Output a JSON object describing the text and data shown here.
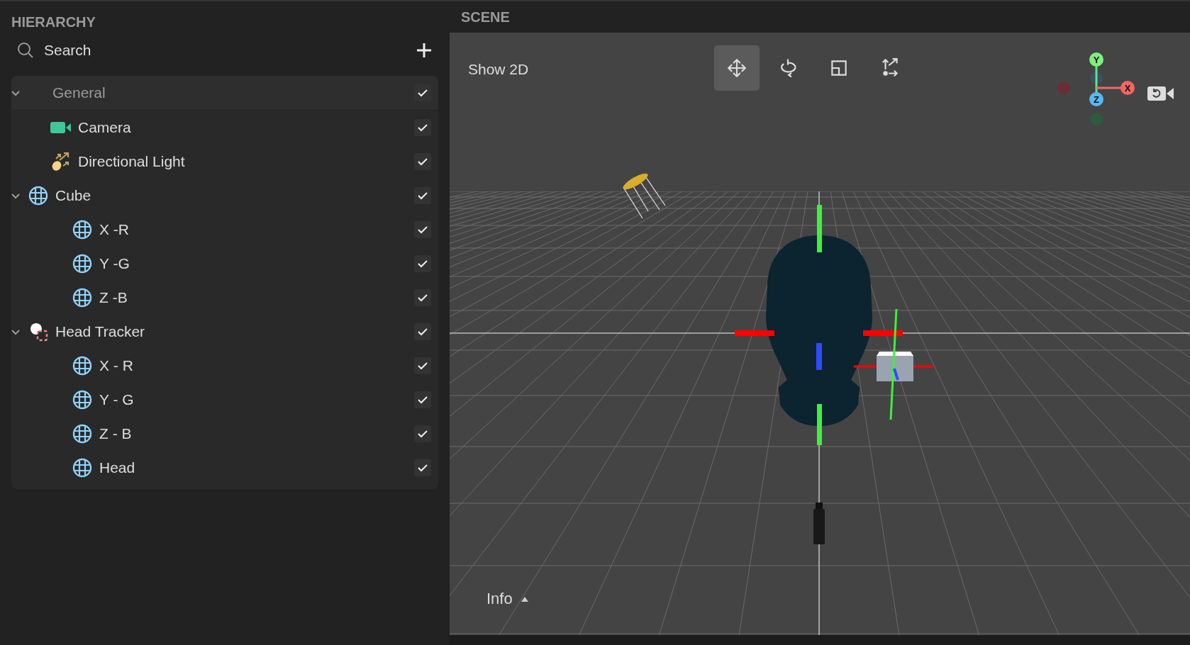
{
  "hierarchy": {
    "title": "HIERARCHY",
    "search": {
      "placeholder": "Search"
    },
    "items": [
      {
        "label": "General",
        "kind": "group",
        "expanded": true,
        "checked": true,
        "children": [
          {
            "label": "Camera",
            "kind": "camera",
            "checked": true
          },
          {
            "label": "Directional Light",
            "kind": "light",
            "checked": true
          },
          {
            "label": "Cube",
            "kind": "mesh",
            "expanded": true,
            "checked": true,
            "children": [
              {
                "label": "X -R",
                "kind": "mesh",
                "checked": true
              },
              {
                "label": "Y -G",
                "kind": "mesh",
                "checked": true
              },
              {
                "label": "Z -B",
                "kind": "mesh",
                "checked": true
              }
            ]
          },
          {
            "label": "Head Tracker",
            "kind": "tracker",
            "expanded": true,
            "checked": true,
            "children": [
              {
                "label": "X - R",
                "kind": "mesh",
                "checked": true
              },
              {
                "label": "Y - G",
                "kind": "mesh",
                "checked": true
              },
              {
                "label": "Z - B",
                "kind": "mesh",
                "checked": true
              },
              {
                "label": "Head",
                "kind": "mesh",
                "checked": true
              }
            ]
          }
        ]
      }
    ]
  },
  "scene": {
    "title": "SCENE",
    "show_2d": "Show 2D",
    "tools": [
      {
        "kind": "move",
        "selected": true
      },
      {
        "kind": "rotate",
        "selected": false
      },
      {
        "kind": "scale",
        "selected": false
      },
      {
        "kind": "pivot",
        "selected": false
      }
    ],
    "gizmo": {
      "y": "Y",
      "x": "X",
      "z": "Z"
    },
    "info": "Info"
  }
}
